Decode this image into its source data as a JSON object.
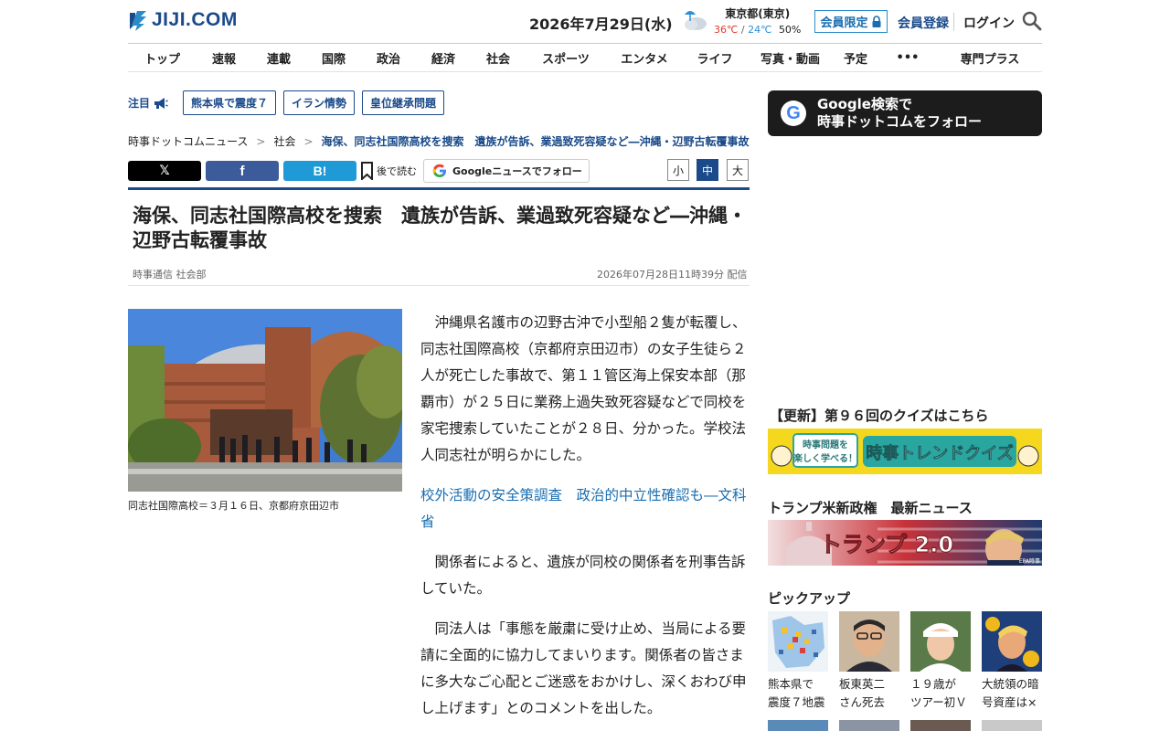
{
  "header": {
    "logo_text": "JIJI.COM",
    "date": "2026年7月29日(水)",
    "weather": {
      "location": "東京都(東京)",
      "high": "36℃",
      "separator": "/",
      "low": "24℃",
      "rain": "50%",
      "icon": "rain-umbrella-icon"
    },
    "member_only": "会員限定",
    "register": "会員登録",
    "login": "ログイン"
  },
  "nav": {
    "items": [
      "トップ",
      "速報",
      "連載",
      "国際",
      "政治",
      "経済",
      "社会",
      "スポーツ",
      "エンタメ",
      "ライフ",
      "写真・動画",
      "予定",
      "•••",
      "専門プラス"
    ]
  },
  "topics": {
    "label": "注目",
    "tags": [
      "熊本県で震度７",
      "イラン情勢",
      "皇位継承問題"
    ]
  },
  "breadcrumb": {
    "items": [
      "時事ドットコムニュース",
      "社会"
    ],
    "separator": ">",
    "current": "海保、同志社国際高校を捜索　遺族が告訴、業過致死容疑など―沖縄・辺野古転覆事故"
  },
  "share": {
    "x_label": "𝕏",
    "facebook_label": "f",
    "hatena_label": "B!",
    "read_later": "後で読む",
    "google_news": "Googleニュースでフォロー",
    "size_small": "小",
    "size_medium": "中",
    "size_large": "大"
  },
  "article": {
    "headline": "海保、同志社国際高校を捜索　遺族が告訴、業過致死容疑など―沖縄・辺野古転覆事故",
    "author": "時事通信 社会部",
    "timestamp": "2026年07月28日11時39分 配信",
    "photo_caption": "同志社国際高校＝３月１６日、京都府京田辺市",
    "paragraph_1": "沖縄県名護市の辺野古沖で小型船２隻が転覆し、同志社国際高校（京都府京田辺市）の女子生徒ら２人が死亡した事故で、第１１管区海上保安本部（那覇市）が２５日に業務上過失致死容疑などで同校を家宅捜索していたことが２８日、分かった。学校法人同志社が明らかにした。",
    "related_link": "校外活動の安全策調査　政治的中立性確認も―文科省",
    "paragraph_2": "関係者によると、遺族が同校の関係者を刑事告訴していた。",
    "paragraph_3": "同法人は「事態を厳粛に受け止め、当局による要請に全面的に協力してまいります。関係者の皆さまに多大なご心配とご迷惑をおかけし、深くおわび申し上げます」とのコメントを出した。"
  },
  "sidebar": {
    "google_follow_line1": "Google検索で",
    "google_follow_line2": "時事ドットコムをフォロー",
    "google_g": "G",
    "quiz_heading": "【更新】第９６回のクイズはこちら",
    "quiz_banner_left": "時事問題を楽しく学べる！",
    "quiz_banner_title": "時事トレンドクイズ",
    "trump_heading": "トランプ米新政権　最新ニュース",
    "trump_banner_title": "トランプ 2.0",
    "trump_banner_credit": "EPA時事",
    "pickup_heading": "ピックアップ",
    "pickup": [
      {
        "line1": "熊本県で",
        "line2": "震度７地震"
      },
      {
        "line1": "板東英二",
        "line2": "さん死去"
      },
      {
        "line1": "１９歳が",
        "line2": "ツアー初Ｖ"
      },
      {
        "line1": "大統領の暗",
        "line2": "号資産は×"
      }
    ]
  },
  "colors": {
    "brand_navy": "#1a4a8a",
    "link_blue": "#1a6eb0",
    "member_border": "#2a8cc8"
  }
}
